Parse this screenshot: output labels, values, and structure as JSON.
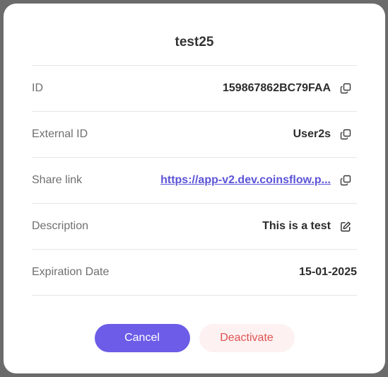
{
  "modal": {
    "title": "test25"
  },
  "details": {
    "id": {
      "label": "ID",
      "value": "159867862BC79FAA",
      "icon": "copy-icon"
    },
    "external_id": {
      "label": "External ID",
      "value": "User2s",
      "icon": "copy-icon"
    },
    "share_link": {
      "label": "Share link",
      "value": "https://app-v2.dev.coinsflow.p...",
      "icon": "copy-icon"
    },
    "description": {
      "label": "Description",
      "value": "This is a test",
      "icon": "edit-icon"
    },
    "expiration_date": {
      "label": "Expiration Date",
      "value": "15-01-2025"
    }
  },
  "actions": {
    "cancel_label": "Cancel",
    "deactivate_label": "Deactivate"
  },
  "colors": {
    "primary": "#6c5ce7",
    "danger": "#e05353",
    "link": "#5b53d6"
  }
}
